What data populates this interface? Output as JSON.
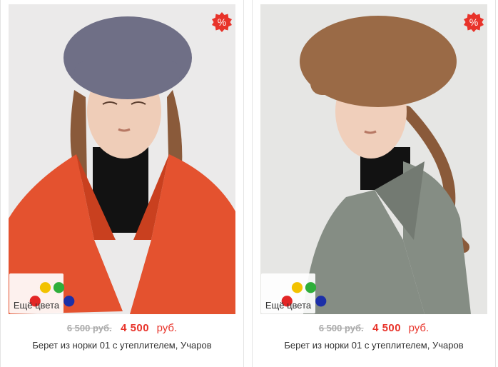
{
  "products": [
    {
      "old_price": "6 500 руб.",
      "new_price": "4 500",
      "currency": "руб.",
      "title": "Берет из норки 01 с утеплителем, Учаров",
      "more_colors_label": "Ещё цвета",
      "sale_badge": "%",
      "hat_color": "#6f6f86",
      "coat_color": "#e4522f",
      "palette_colors": [
        "#f2c200",
        "#2fae3a",
        "#e32626",
        "#1c2fa8"
      ]
    },
    {
      "old_price": "6 500 руб.",
      "new_price": "4 500",
      "currency": "руб.",
      "title": "Берет из норки 01 с утеплителем, Учаров",
      "more_colors_label": "Ещё цвета",
      "sale_badge": "%",
      "hat_color": "#9a6a46",
      "coat_color": "#858d84",
      "palette_colors": [
        "#f2c200",
        "#2fae3a",
        "#e32626",
        "#1c2fa8"
      ]
    }
  ],
  "colors": {
    "accent_red": "#e8332a",
    "old_price_gray": "#aaaaaa",
    "text": "#333333"
  }
}
